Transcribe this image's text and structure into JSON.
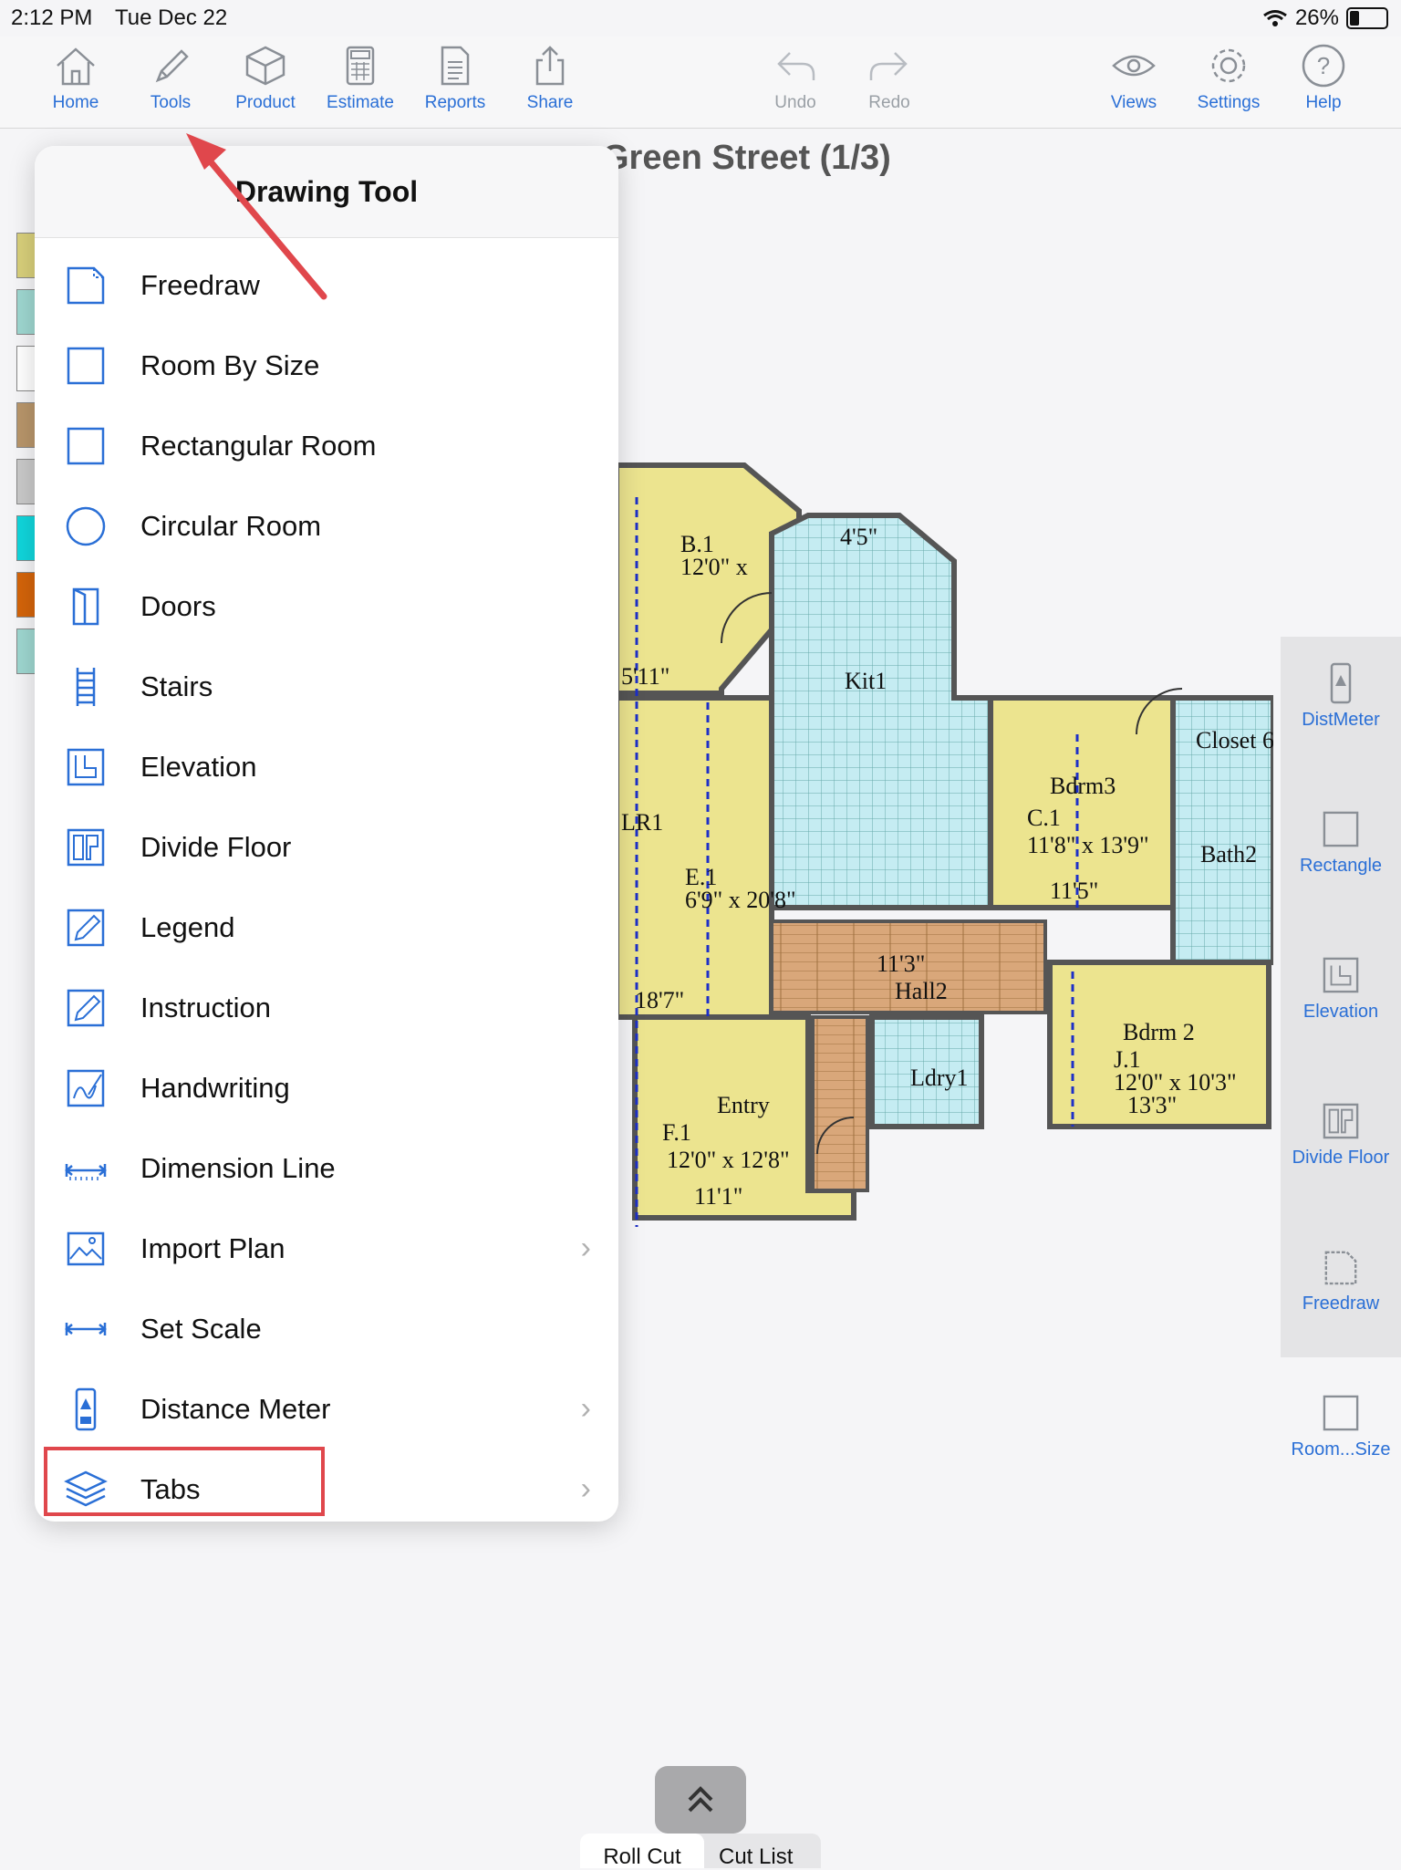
{
  "status": {
    "time": "2:12 PM",
    "date": "Tue Dec 22",
    "battery": "26%"
  },
  "toolbar": {
    "home": "Home",
    "tools": "Tools",
    "product": "Product",
    "estimate": "Estimate",
    "reports": "Reports",
    "share": "Share",
    "undo": "Undo",
    "redo": "Redo",
    "views": "Views",
    "settings": "Settings",
    "help": "Help"
  },
  "plan": {
    "title": "Green Street (1/3)",
    "labels": {
      "kit": "Kit1",
      "lr": "LR1",
      "bdrm3": "Bdrm3",
      "bdrm2": "Bdrm 2",
      "bath2": "Bath2",
      "entry": "Entry",
      "hall": "Hall2",
      "ldry": "Ldry1",
      "closet6": "Closet 6",
      "b1": "B.1",
      "c1": "C.1",
      "e1": "E.1",
      "f1": "F.1",
      "j1": "J.1",
      "d_kit_top": "4'5\"",
      "d_b1": "12'0\" x",
      "d_bdrm3": "11'8\" x 13'9\"",
      "d_bdrm3_b": "11'5\"",
      "d_lr": "6'9\" x 20'8\"",
      "d_entry": "12'0\" x 12'8\"",
      "d_entry_b": "11'1\"",
      "d_bdrm2": "12'0\" x 10'3\"",
      "d_bdrm2_b": "13'3\"",
      "d_lr_b": "18'7\"",
      "d_511": "5'11\"",
      "d_hall": "11'3\""
    }
  },
  "menu": {
    "title": "Drawing Tool",
    "items": [
      {
        "label": "Freedraw"
      },
      {
        "label": "Room By Size"
      },
      {
        "label": "Rectangular Room"
      },
      {
        "label": "Circular Room"
      },
      {
        "label": "Doors"
      },
      {
        "label": "Stairs"
      },
      {
        "label": "Elevation"
      },
      {
        "label": "Divide Floor"
      },
      {
        "label": "Legend"
      },
      {
        "label": "Instruction"
      },
      {
        "label": "Handwriting"
      },
      {
        "label": "Dimension Line"
      },
      {
        "label": "Import Plan"
      },
      {
        "label": "Set Scale"
      },
      {
        "label": "Distance Meter"
      },
      {
        "label": "Tabs"
      }
    ]
  },
  "right_panel": {
    "items": [
      {
        "label": "DistMeter"
      },
      {
        "label": "Rectangle"
      },
      {
        "label": "Elevation"
      },
      {
        "label": "Divide Floor"
      },
      {
        "label": "Freedraw"
      },
      {
        "label": "Room...Size"
      }
    ]
  },
  "bottom": {
    "tab_active": "Roll Cut",
    "tab_other": "Cut List"
  },
  "colors": {
    "accent": "#2a6fd6",
    "highlight": "#e0474c",
    "room_yellow": "#ece48f",
    "tile_blue": "#bfeaf0",
    "wood": "#d9a77a"
  }
}
